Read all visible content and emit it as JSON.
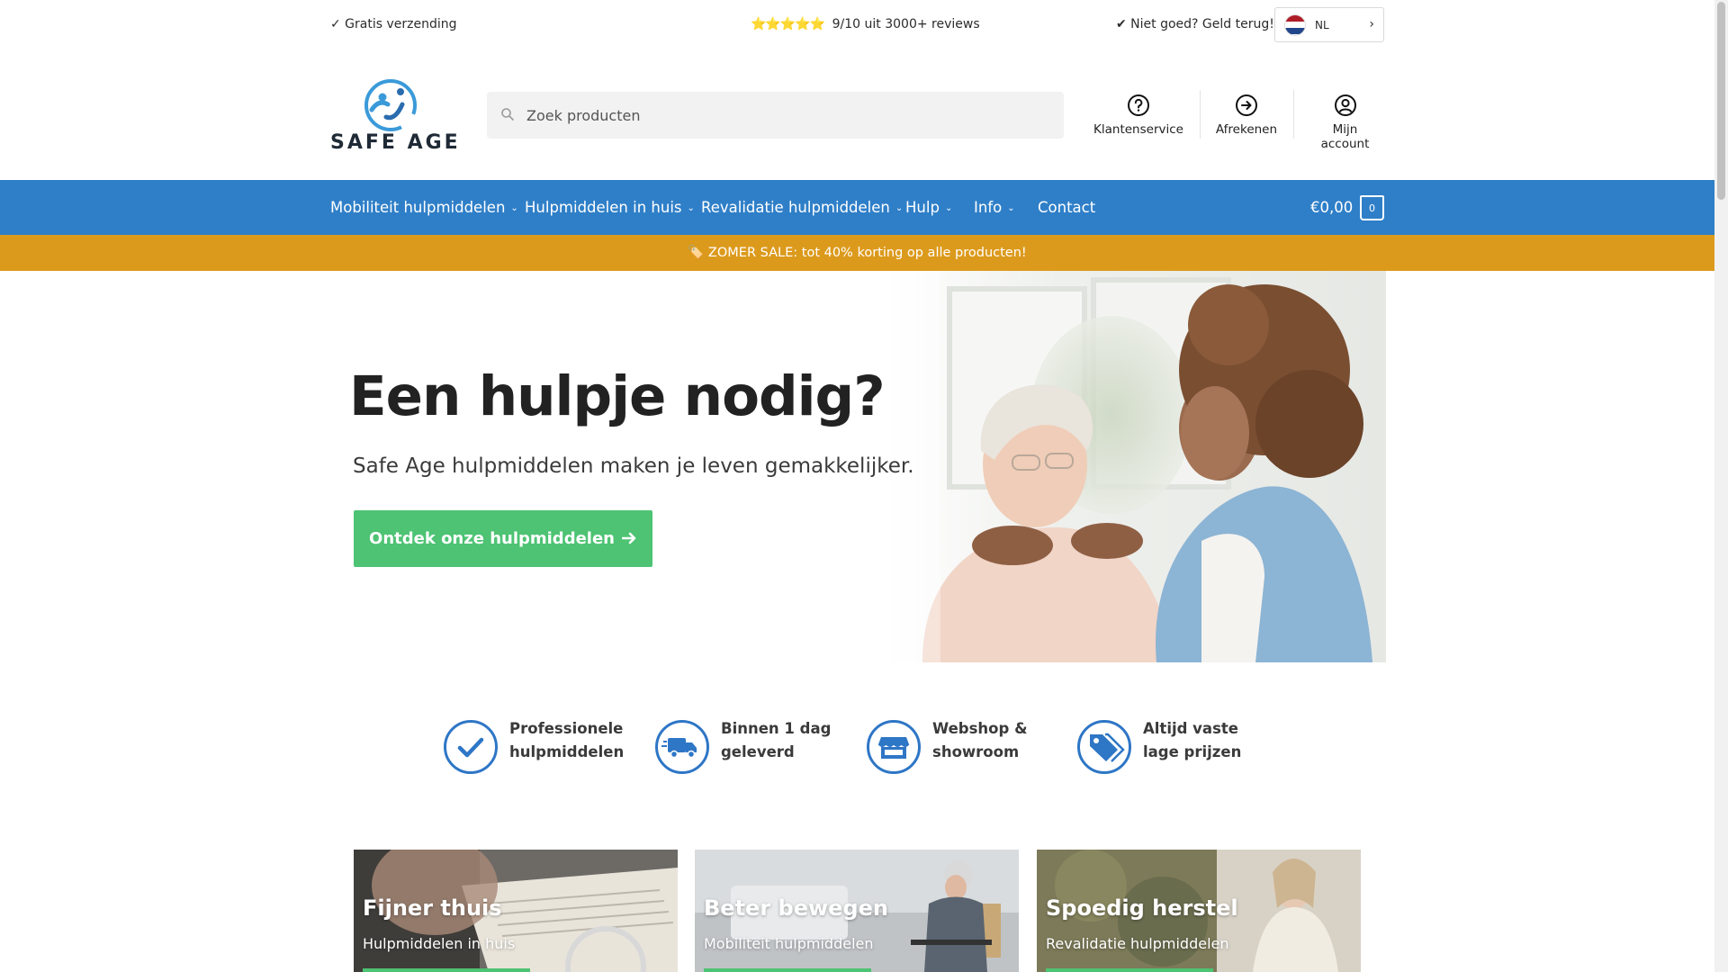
{
  "topbar": {
    "free_shipping": "✓ Gratis verzending",
    "stars": "⭐⭐⭐⭐⭐",
    "rating": "9/10 uit 3000+ reviews",
    "guarantee": "✔ Niet goed? Geld terug!",
    "language": "NL"
  },
  "brand": {
    "logo_text": "SAFE AGE"
  },
  "search": {
    "placeholder": "Zoek producten"
  },
  "header_links": {
    "customer_service": "Klantenservice",
    "checkout": "Afrekenen",
    "account": "Mijn account"
  },
  "nav": {
    "items": [
      {
        "label": "Mobiliteit hulpmiddelen",
        "dropdown": true
      },
      {
        "label": "Hulpmiddelen in huis",
        "dropdown": true
      },
      {
        "label": "Revalidatie hulpmiddelen",
        "dropdown": true
      },
      {
        "label": "Hulp",
        "dropdown": true
      },
      {
        "label": "Info",
        "dropdown": true
      },
      {
        "label": "Contact",
        "dropdown": false
      }
    ],
    "cart_total": "€0,00",
    "cart_count": "0"
  },
  "promo": {
    "text": "🏷️ ZOMER SALE: tot 40% korting op alle producten!"
  },
  "hero": {
    "title": "Een hulpje nodig?",
    "subtitle": "Safe Age hulpmiddelen maken je leven gemakkelijker.",
    "cta": "Ontdek onze hulpmiddelen"
  },
  "features": [
    {
      "icon": "checkmark-icon",
      "text": "Professionele hulpmiddelen"
    },
    {
      "icon": "delivery-truck-icon",
      "text": "Binnen 1 dag geleverd"
    },
    {
      "icon": "store-icon",
      "text": "Webshop & showroom"
    },
    {
      "icon": "price-tag-icon",
      "text": "Altijd vaste lage prijzen"
    }
  ],
  "cards": [
    {
      "title": "Fijner thuis",
      "subtitle": "Hulpmiddelen in huis"
    },
    {
      "title": "Beter bewegen",
      "subtitle": "Mobiliteit hulpmiddelen"
    },
    {
      "title": "Spoedig herstel",
      "subtitle": "Revalidatie hulpmiddelen"
    }
  ],
  "colors": {
    "nav_blue": "#2f7fc8",
    "promo_orange": "#dc9a1c",
    "cta_green": "#4dc373",
    "icon_blue": "#2e76c6"
  }
}
